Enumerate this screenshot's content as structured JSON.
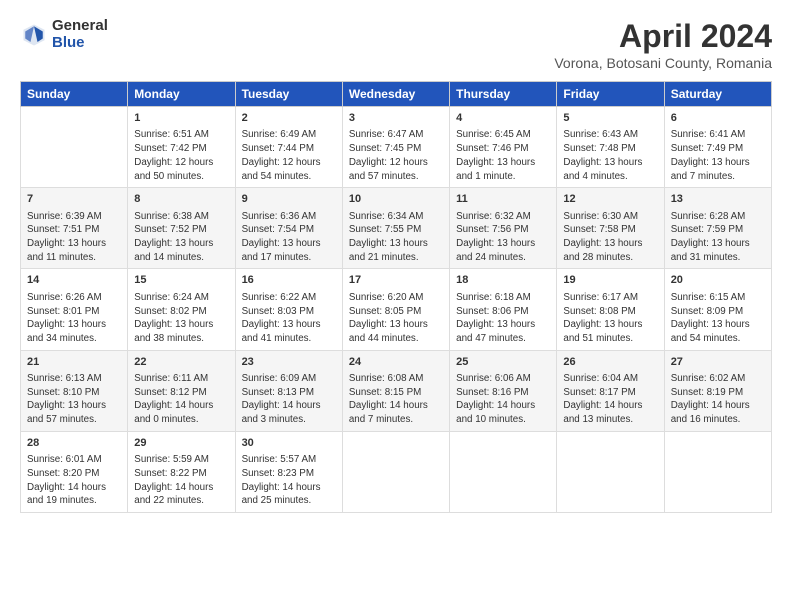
{
  "header": {
    "logo_general": "General",
    "logo_blue": "Blue",
    "month_title": "April 2024",
    "location": "Vorona, Botosani County, Romania"
  },
  "days_of_week": [
    "Sunday",
    "Monday",
    "Tuesday",
    "Wednesday",
    "Thursday",
    "Friday",
    "Saturday"
  ],
  "weeks": [
    [
      {
        "day": "",
        "sunrise": "",
        "sunset": "",
        "daylight": ""
      },
      {
        "day": "1",
        "sunrise": "Sunrise: 6:51 AM",
        "sunset": "Sunset: 7:42 PM",
        "daylight": "Daylight: 12 hours and 50 minutes."
      },
      {
        "day": "2",
        "sunrise": "Sunrise: 6:49 AM",
        "sunset": "Sunset: 7:44 PM",
        "daylight": "Daylight: 12 hours and 54 minutes."
      },
      {
        "day": "3",
        "sunrise": "Sunrise: 6:47 AM",
        "sunset": "Sunset: 7:45 PM",
        "daylight": "Daylight: 12 hours and 57 minutes."
      },
      {
        "day": "4",
        "sunrise": "Sunrise: 6:45 AM",
        "sunset": "Sunset: 7:46 PM",
        "daylight": "Daylight: 13 hours and 1 minute."
      },
      {
        "day": "5",
        "sunrise": "Sunrise: 6:43 AM",
        "sunset": "Sunset: 7:48 PM",
        "daylight": "Daylight: 13 hours and 4 minutes."
      },
      {
        "day": "6",
        "sunrise": "Sunrise: 6:41 AM",
        "sunset": "Sunset: 7:49 PM",
        "daylight": "Daylight: 13 hours and 7 minutes."
      }
    ],
    [
      {
        "day": "7",
        "sunrise": "Sunrise: 6:39 AM",
        "sunset": "Sunset: 7:51 PM",
        "daylight": "Daylight: 13 hours and 11 minutes."
      },
      {
        "day": "8",
        "sunrise": "Sunrise: 6:38 AM",
        "sunset": "Sunset: 7:52 PM",
        "daylight": "Daylight: 13 hours and 14 minutes."
      },
      {
        "day": "9",
        "sunrise": "Sunrise: 6:36 AM",
        "sunset": "Sunset: 7:54 PM",
        "daylight": "Daylight: 13 hours and 17 minutes."
      },
      {
        "day": "10",
        "sunrise": "Sunrise: 6:34 AM",
        "sunset": "Sunset: 7:55 PM",
        "daylight": "Daylight: 13 hours and 21 minutes."
      },
      {
        "day": "11",
        "sunrise": "Sunrise: 6:32 AM",
        "sunset": "Sunset: 7:56 PM",
        "daylight": "Daylight: 13 hours and 24 minutes."
      },
      {
        "day": "12",
        "sunrise": "Sunrise: 6:30 AM",
        "sunset": "Sunset: 7:58 PM",
        "daylight": "Daylight: 13 hours and 28 minutes."
      },
      {
        "day": "13",
        "sunrise": "Sunrise: 6:28 AM",
        "sunset": "Sunset: 7:59 PM",
        "daylight": "Daylight: 13 hours and 31 minutes."
      }
    ],
    [
      {
        "day": "14",
        "sunrise": "Sunrise: 6:26 AM",
        "sunset": "Sunset: 8:01 PM",
        "daylight": "Daylight: 13 hours and 34 minutes."
      },
      {
        "day": "15",
        "sunrise": "Sunrise: 6:24 AM",
        "sunset": "Sunset: 8:02 PM",
        "daylight": "Daylight: 13 hours and 38 minutes."
      },
      {
        "day": "16",
        "sunrise": "Sunrise: 6:22 AM",
        "sunset": "Sunset: 8:03 PM",
        "daylight": "Daylight: 13 hours and 41 minutes."
      },
      {
        "day": "17",
        "sunrise": "Sunrise: 6:20 AM",
        "sunset": "Sunset: 8:05 PM",
        "daylight": "Daylight: 13 hours and 44 minutes."
      },
      {
        "day": "18",
        "sunrise": "Sunrise: 6:18 AM",
        "sunset": "Sunset: 8:06 PM",
        "daylight": "Daylight: 13 hours and 47 minutes."
      },
      {
        "day": "19",
        "sunrise": "Sunrise: 6:17 AM",
        "sunset": "Sunset: 8:08 PM",
        "daylight": "Daylight: 13 hours and 51 minutes."
      },
      {
        "day": "20",
        "sunrise": "Sunrise: 6:15 AM",
        "sunset": "Sunset: 8:09 PM",
        "daylight": "Daylight: 13 hours and 54 minutes."
      }
    ],
    [
      {
        "day": "21",
        "sunrise": "Sunrise: 6:13 AM",
        "sunset": "Sunset: 8:10 PM",
        "daylight": "Daylight: 13 hours and 57 minutes."
      },
      {
        "day": "22",
        "sunrise": "Sunrise: 6:11 AM",
        "sunset": "Sunset: 8:12 PM",
        "daylight": "Daylight: 14 hours and 0 minutes."
      },
      {
        "day": "23",
        "sunrise": "Sunrise: 6:09 AM",
        "sunset": "Sunset: 8:13 PM",
        "daylight": "Daylight: 14 hours and 3 minutes."
      },
      {
        "day": "24",
        "sunrise": "Sunrise: 6:08 AM",
        "sunset": "Sunset: 8:15 PM",
        "daylight": "Daylight: 14 hours and 7 minutes."
      },
      {
        "day": "25",
        "sunrise": "Sunrise: 6:06 AM",
        "sunset": "Sunset: 8:16 PM",
        "daylight": "Daylight: 14 hours and 10 minutes."
      },
      {
        "day": "26",
        "sunrise": "Sunrise: 6:04 AM",
        "sunset": "Sunset: 8:17 PM",
        "daylight": "Daylight: 14 hours and 13 minutes."
      },
      {
        "day": "27",
        "sunrise": "Sunrise: 6:02 AM",
        "sunset": "Sunset: 8:19 PM",
        "daylight": "Daylight: 14 hours and 16 minutes."
      }
    ],
    [
      {
        "day": "28",
        "sunrise": "Sunrise: 6:01 AM",
        "sunset": "Sunset: 8:20 PM",
        "daylight": "Daylight: 14 hours and 19 minutes."
      },
      {
        "day": "29",
        "sunrise": "Sunrise: 5:59 AM",
        "sunset": "Sunset: 8:22 PM",
        "daylight": "Daylight: 14 hours and 22 minutes."
      },
      {
        "day": "30",
        "sunrise": "Sunrise: 5:57 AM",
        "sunset": "Sunset: 8:23 PM",
        "daylight": "Daylight: 14 hours and 25 minutes."
      },
      {
        "day": "",
        "sunrise": "",
        "sunset": "",
        "daylight": ""
      },
      {
        "day": "",
        "sunrise": "",
        "sunset": "",
        "daylight": ""
      },
      {
        "day": "",
        "sunrise": "",
        "sunset": "",
        "daylight": ""
      },
      {
        "day": "",
        "sunrise": "",
        "sunset": "",
        "daylight": ""
      }
    ]
  ]
}
